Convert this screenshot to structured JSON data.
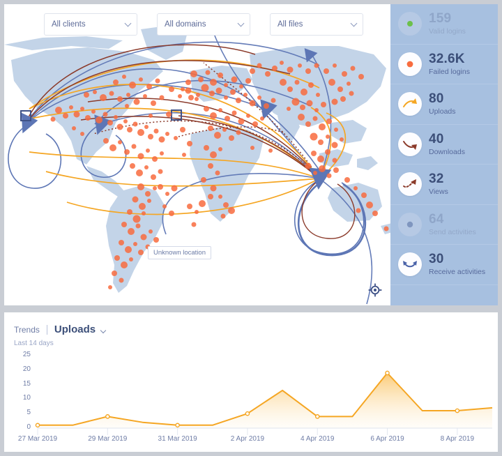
{
  "filters": [
    {
      "label": "All clients",
      "name": "clients-filter"
    },
    {
      "label": "All domains",
      "name": "domains-filter"
    },
    {
      "label": "All files",
      "name": "files-filter"
    }
  ],
  "map": {
    "unknown_location_label": "Unknown location",
    "locate_icon": "crosshair-target-icon",
    "land_color": "#c3d4e8",
    "dot_color": "#f86c3f",
    "arc_colors": {
      "blue": "#5d76b5",
      "orange": "#f5a623",
      "darkred": "#8b3a2a"
    }
  },
  "stats": [
    {
      "value": "159",
      "label": "Valid logins",
      "icon": "green-dot-icon",
      "active": false,
      "accent": "#6cc04a"
    },
    {
      "value": "32.6K",
      "label": "Failed logins",
      "icon": "orange-dot-icon",
      "active": true,
      "accent": "#f86c3f"
    },
    {
      "value": "80",
      "label": "Uploads",
      "icon": "upload-arrow-icon",
      "active": true,
      "accent": "#f5a623"
    },
    {
      "value": "40",
      "label": "Downloads",
      "icon": "download-arrow-icon",
      "active": true,
      "accent": "#8b3a2a"
    },
    {
      "value": "32",
      "label": "Views",
      "icon": "view-dotted-arrow-icon",
      "active": true,
      "accent": "#8b3a2a"
    },
    {
      "value": "64",
      "label": "Send activities",
      "icon": "send-dot-icon",
      "active": false,
      "accent": "#7f96bf"
    },
    {
      "value": "30",
      "label": "Receive activities",
      "icon": "receive-double-arrow-icon",
      "active": true,
      "accent": "#4a62a8"
    }
  ],
  "trends": {
    "title": "Trends",
    "metric": "Uploads",
    "metric_chevron_icon": "chevron-down-icon",
    "subtitle": "Last 14 days"
  },
  "chart_data": {
    "type": "area",
    "title": "Uploads",
    "subtitle": "Last 14 days",
    "xlabel": "",
    "ylabel": "",
    "ylim": [
      0,
      25
    ],
    "yticks": [
      0,
      5,
      10,
      15,
      20,
      25
    ],
    "grid": true,
    "legend": false,
    "line_color": "#f5a623",
    "fill_color": "#fde3b0",
    "x": [
      "27 Mar 2019",
      "28 Mar 2019",
      "29 Mar 2019",
      "30 Mar 2019",
      "31 Mar 2019",
      "1 Apr 2019",
      "2 Apr 2019",
      "3 Apr 2019",
      "4 Apr 2019",
      "5 Apr 2019",
      "6 Apr 2019",
      "7 Apr 2019",
      "8 Apr 2019",
      "9 Apr 2019"
    ],
    "xtick_labels": [
      "27 Mar 2019",
      "29 Mar 2019",
      "31 Mar 2019",
      "2 Apr 2019",
      "4 Apr 2019",
      "6 Apr 2019",
      "8 Apr 2019"
    ],
    "values": [
      1,
      1,
      4,
      2,
      1,
      1,
      5,
      13,
      4,
      4,
      19,
      6,
      6,
      7
    ],
    "markers_at": [
      0,
      2,
      4,
      6,
      8,
      10,
      12
    ]
  }
}
